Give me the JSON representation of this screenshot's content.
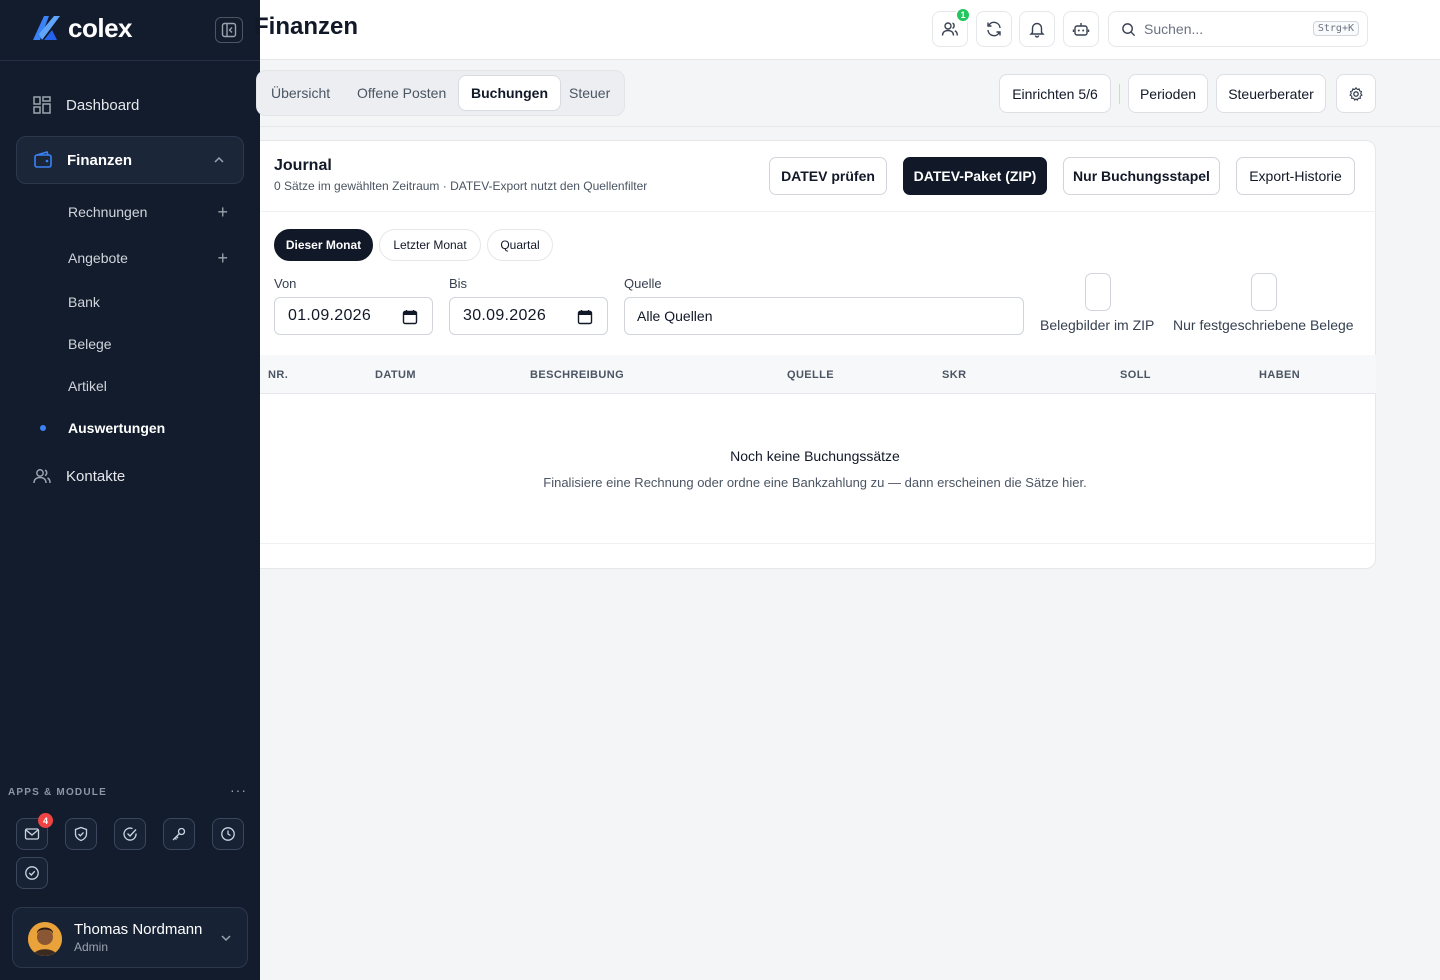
{
  "brand": {
    "name": "colex"
  },
  "sidebar": {
    "nav": {
      "dashboard": "Dashboard",
      "finanzen": "Finanzen",
      "kontakte": "Kontakte"
    },
    "sub": {
      "rechnungen": "Rechnungen",
      "angebote": "Angebote",
      "bank": "Bank",
      "belege": "Belege",
      "artikel": "Artikel",
      "auswertungen": "Auswertungen"
    },
    "plus": "+",
    "apps_title": "APPS & MODULE",
    "apps_more": "···",
    "mail_badge": "4",
    "user": {
      "name": "Thomas Nordmann",
      "role": "Admin"
    }
  },
  "header": {
    "title": "Finanzen",
    "team_badge": "1",
    "search_placeholder": "Suchen...",
    "search_shortcut": "Strg+K"
  },
  "tabs": [
    "Übersicht",
    "Offene Posten",
    "Buchungen",
    "Steuer"
  ],
  "toolbar": {
    "einrichten": "Einrichten 5/6",
    "perioden": "Perioden",
    "steuerberater": "Steuerberater"
  },
  "journal": {
    "title": "Journal",
    "subtitle": "0 Sätze im gewählten Zeitraum · DATEV-Export nutzt den Quellenfilter",
    "buttons": {
      "pruefen": "DATEV prüfen",
      "paket": "DATEV-Paket (ZIP)",
      "stapel": "Nur Buchungsstapel",
      "historie": "Export-Historie"
    },
    "chips": [
      "Dieser Monat",
      "Letzter Monat",
      "Quartal"
    ],
    "labels": {
      "von": "Von",
      "bis": "Bis",
      "quelle": "Quelle"
    },
    "von": "01.09.2026",
    "bis": "30.09.2026",
    "quelle": "Alle Quellen",
    "checks": {
      "belegbilder": "Belegbilder im ZIP",
      "festgeschrieben": "Nur festgeschriebene Belege"
    },
    "columns": [
      "NR.",
      "DATUM",
      "BESCHREIBUNG",
      "QUELLE",
      "SKR",
      "SOLL",
      "HABEN"
    ],
    "empty_title": "Noch keine Buchungssätze",
    "empty_subtitle": "Finalisiere eine Rechnung oder ordne eine Bankzahlung zu — dann erscheinen die Sätze hier."
  }
}
